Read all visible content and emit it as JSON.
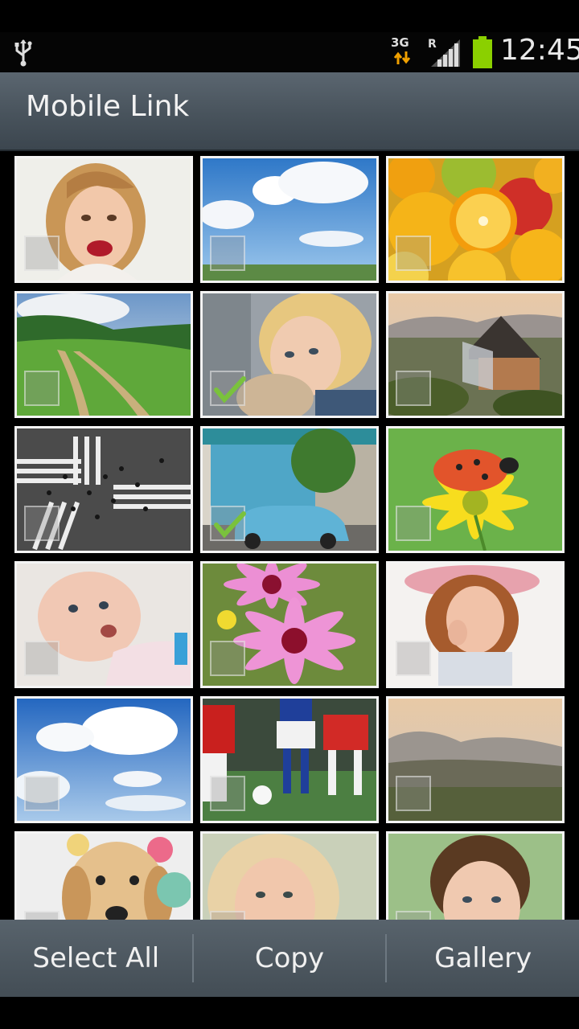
{
  "status_bar": {
    "network_type": "3G",
    "roaming": "R",
    "time": "12:45",
    "battery_color": "#8bd000",
    "icons": [
      "usb-icon",
      "data-arrows-icon",
      "signal-icon",
      "battery-icon"
    ]
  },
  "title_bar": {
    "title": "Mobile Link"
  },
  "photos": [
    {
      "subject": "girl-laughing",
      "checked": false
    },
    {
      "subject": "blue-sky-clouds",
      "checked": false
    },
    {
      "subject": "fruits",
      "checked": false
    },
    {
      "subject": "green-hills-path",
      "checked": false
    },
    {
      "subject": "girl-with-teddy",
      "checked": true
    },
    {
      "subject": "house-landscape",
      "checked": false
    },
    {
      "subject": "crosswalk-crowd",
      "checked": false
    },
    {
      "subject": "blue-car-street",
      "checked": true
    },
    {
      "subject": "ladybug-flower",
      "checked": false
    },
    {
      "subject": "baby",
      "checked": false
    },
    {
      "subject": "pink-flowers",
      "checked": false
    },
    {
      "subject": "girl-on-phone",
      "checked": false
    },
    {
      "subject": "sky-clouds",
      "checked": false
    },
    {
      "subject": "soccer-players",
      "checked": false
    },
    {
      "subject": "hazy-landscape",
      "checked": false
    },
    {
      "subject": "puppy",
      "checked": false
    },
    {
      "subject": "smiling-woman",
      "checked": false
    },
    {
      "subject": "boy-portrait",
      "checked": false
    }
  ],
  "bottom_bar": {
    "select_all_label": "Select All",
    "copy_label": "Copy",
    "gallery_label": "Gallery"
  }
}
